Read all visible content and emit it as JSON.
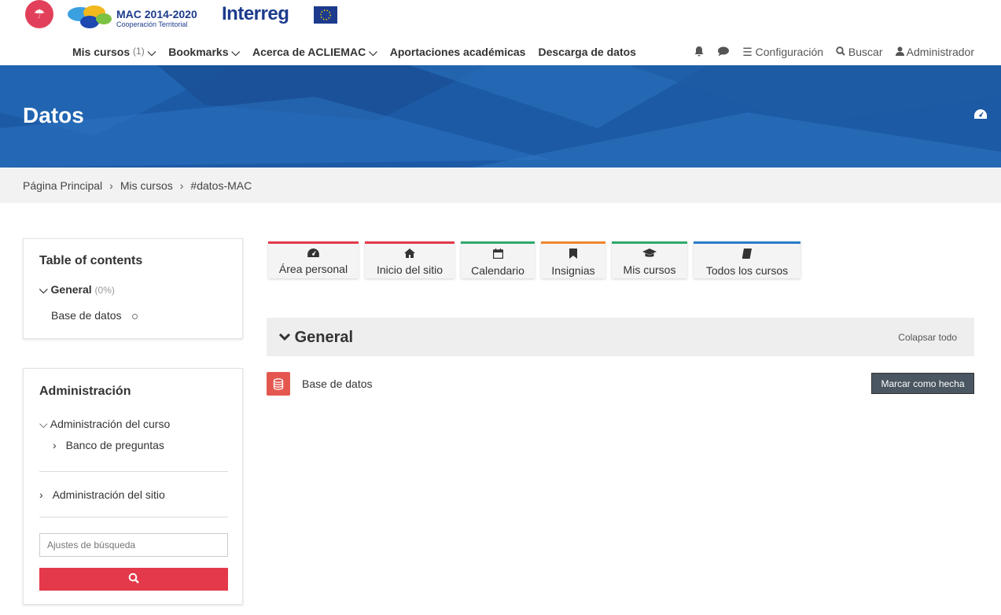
{
  "header": {
    "logo_mac_title": "MAC 2014-2020",
    "logo_mac_sub": "Cooperación Territorial",
    "logo_interreg": "Interreg",
    "nav": {
      "mis_cursos": "Mis cursos",
      "mis_cursos_count": "(1)",
      "bookmarks": "Bookmarks",
      "acerca": "Acerca de ACLIEMAC",
      "aportaciones": "Aportaciones académicas",
      "descarga": "Descarga de datos"
    },
    "right": {
      "configuracion": "Configuración",
      "buscar": "Buscar",
      "administrador": "Administrador"
    }
  },
  "banner": {
    "title": "Datos",
    "accent": "#1c5aa6"
  },
  "breadcrumb": [
    "Página Principal",
    "Mis cursos",
    "#datos-MAC"
  ],
  "toc": {
    "title": "Table of contents",
    "section": "General",
    "section_pct": "(0%)",
    "item": "Base de datos"
  },
  "admin": {
    "title": "Administración",
    "curso": "Administración del curso",
    "banco": "Banco de preguntas",
    "sitio": "Administración del sitio",
    "search_placeholder": "Ajustes de búsqueda"
  },
  "quicklinks": [
    {
      "label": "Área personal",
      "icon": "dashboard-icon",
      "color": "#e4394a"
    },
    {
      "label": "Inicio del sitio",
      "icon": "home-icon",
      "color": "#e4394a"
    },
    {
      "label": "Calendario",
      "icon": "calendar-icon",
      "color": "#2eaa6b"
    },
    {
      "label": "Insignias",
      "icon": "bookmark-icon",
      "color": "#f0862c"
    },
    {
      "label": "Mis cursos",
      "icon": "graduation-cap-icon",
      "color": "#2eaa6b"
    },
    {
      "label": "Todos los cursos",
      "icon": "book-icon",
      "color": "#2a7ac9"
    }
  ],
  "section": {
    "title": "General",
    "collapse_all": "Colapsar todo",
    "activity": "Base de datos",
    "mark_done": "Marcar como hecha"
  }
}
